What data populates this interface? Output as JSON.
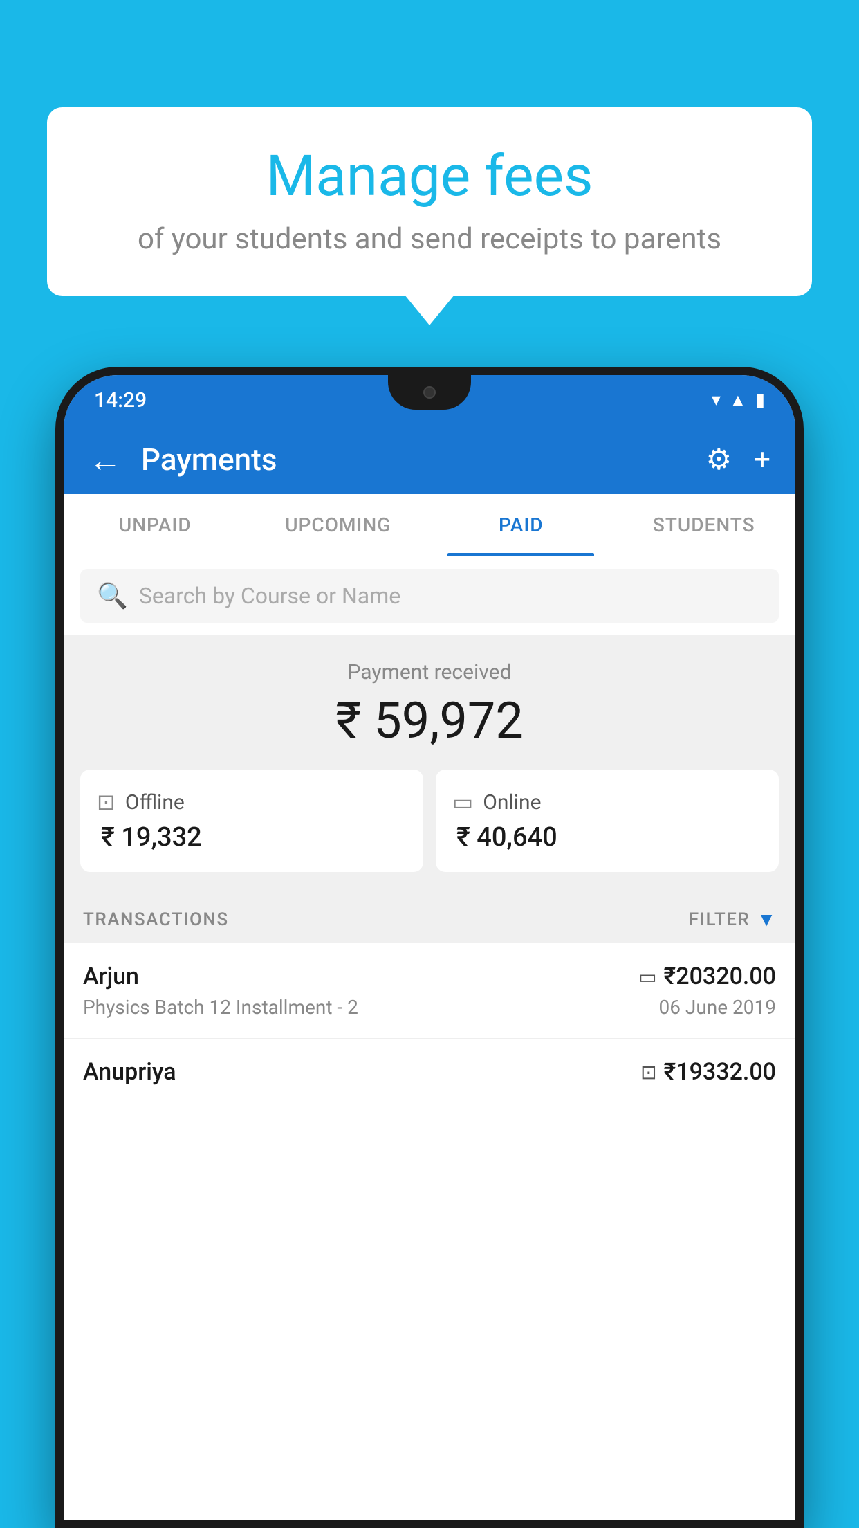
{
  "background_color": "#1ab8e8",
  "tooltip": {
    "title": "Manage fees",
    "subtitle": "of your students and send receipts to parents"
  },
  "status_bar": {
    "time": "14:29"
  },
  "app_bar": {
    "title": "Payments",
    "back_label": "←",
    "gear_label": "⚙",
    "plus_label": "+"
  },
  "tabs": [
    {
      "label": "UNPAID",
      "active": false
    },
    {
      "label": "UPCOMING",
      "active": false
    },
    {
      "label": "PAID",
      "active": true
    },
    {
      "label": "STUDENTS",
      "active": false
    }
  ],
  "search": {
    "placeholder": "Search by Course or Name"
  },
  "payment_summary": {
    "received_label": "Payment received",
    "total_amount": "₹ 59,972",
    "offline_label": "Offline",
    "offline_amount": "₹ 19,332",
    "online_label": "Online",
    "online_amount": "₹ 40,640"
  },
  "transactions": {
    "section_label": "TRANSACTIONS",
    "filter_label": "FILTER",
    "items": [
      {
        "name": "Arjun",
        "course": "Physics Batch 12 Installment - 2",
        "amount": "₹20320.00",
        "date": "06 June 2019",
        "payment_type": "online"
      },
      {
        "name": "Anupriya",
        "course": "",
        "amount": "₹19332.00",
        "date": "",
        "payment_type": "offline"
      }
    ]
  }
}
